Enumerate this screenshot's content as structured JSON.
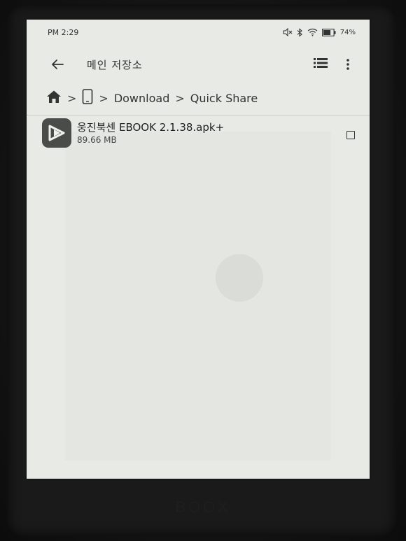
{
  "status_bar": {
    "time": "PM 2:29",
    "battery": "74%",
    "icons": [
      "mute-icon",
      "bluetooth-icon",
      "wifi-icon",
      "battery-icon"
    ]
  },
  "app_bar": {
    "title": "메인 저장소",
    "back_icon": "back-arrow-icon",
    "view_toggle_icon": "list-view-icon",
    "more_icon": "more-vert-icon"
  },
  "breadcrumb": {
    "home_icon": "home-icon",
    "device_icon": "phone-icon",
    "separator": ">",
    "items": [
      "Download",
      "Quick Share"
    ]
  },
  "files": [
    {
      "name": "웅진북센 EBOOK 2.1.38.apk+",
      "size": "89.66 MB",
      "icon": "app-play-icon",
      "checked": false
    }
  ],
  "device": {
    "brand": "BOOX"
  }
}
